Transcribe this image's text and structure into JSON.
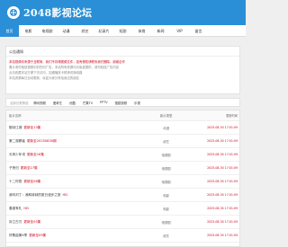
{
  "site": {
    "name": "2048影视论坛"
  },
  "nav": {
    "items": [
      {
        "label": "首页",
        "active": true
      },
      {
        "label": "电影"
      },
      {
        "label": "电视剧"
      },
      {
        "label": "动漫"
      },
      {
        "label": "综艺"
      },
      {
        "label": "纪录片"
      },
      {
        "label": "短剧"
      },
      {
        "label": "体育"
      },
      {
        "label": "新闻"
      },
      {
        "label": "VIP"
      },
      {
        "label": "留言"
      }
    ]
  },
  "notice": {
    "title": "公告通知",
    "lines": [
      "本站视频均来源于互联网，我们不存储视频文件，如有侵权请联系我们删除，谢谢合作",
      "看片请勿相信视频中的任何广告，本站所有资源均为免费提供，请勿轻信广告内容",
      "点击收藏本站方便下次访问，如遇播放卡顿请切换线路",
      "本站资源每日自动更新，欢迎大家分享给身边的朋友"
    ]
  },
  "filter": {
    "label": "全部分类筛选",
    "items": [
      "腾讯视频",
      "爱奇艺",
      "优酷",
      "芒果TV",
      "PPTV",
      "搜狐视频",
      "乐视"
    ]
  },
  "table": {
    "headers": {
      "title": "影片名称",
      "category": "影片类型",
      "time": "更新时间"
    },
    "rows": [
      {
        "title": "御剑江湖",
        "update": "更新至13集",
        "category": "动漫",
        "time": "2025-08-30 17:01:09"
      },
      {
        "title": "第二观察者",
        "update": "更新至20250830期",
        "category": "综艺",
        "time": "2025-08-30 17:01:09"
      },
      {
        "title": "长风少年词",
        "update": "更新至18集",
        "category": "电视剧",
        "time": "2025-08-30 17:01:09"
      },
      {
        "title": "子夜归",
        "update": "更新至27集",
        "category": "电视剧",
        "time": "2025-08-30 17:01:09"
      },
      {
        "title": "十二时辰",
        "update": "更新至08集",
        "category": "电视剧",
        "time": "2025-08-30 17:01:09"
      },
      {
        "title": "我叫刘丁：我和妹妹的夏日漫步之旅",
        "update": "HD",
        "category": "电影",
        "time": "2025-08-30 17:01:09"
      },
      {
        "title": "春香有礼",
        "update": "HD",
        "category": "电影",
        "time": "2025-08-30 17:01:09"
      },
      {
        "title": "封之古刃",
        "update": "更新至05集",
        "category": "电视剧",
        "time": "2025-08-30 17:01:09"
      },
      {
        "title": "好歌曲第4季",
        "update": "更新至09集",
        "category": "综艺",
        "time": "2025-08-30 17:01:09"
      }
    ]
  }
}
